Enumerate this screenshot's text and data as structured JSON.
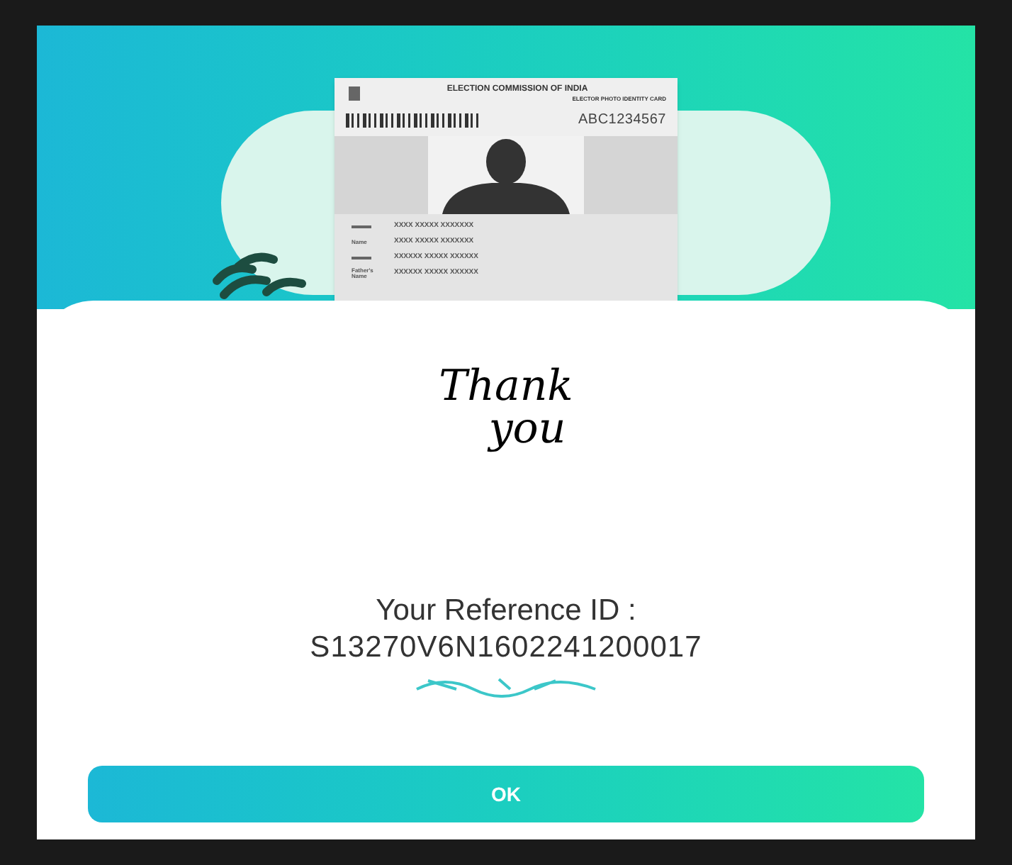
{
  "id_card": {
    "authority": "ELECTION COMMISSION OF INDIA",
    "card_type": "ELECTOR PHOTO IDENTITY CARD",
    "number": "ABC1234567",
    "fields": [
      {
        "value": "XXXX XXXXX XXXXXXX"
      },
      {
        "label": "Name",
        "value": "XXXX XXXXX XXXXXXX"
      },
      {
        "value": "XXXXXX XXXXX XXXXXX"
      },
      {
        "label": "Father's Name",
        "value": "XXXXXX XXXXX XXXXXX"
      }
    ]
  },
  "thank_you": [
    "Thank",
    "you"
  ],
  "reference": {
    "label": "Your Reference ID :",
    "value": "S13270V6N1602241200017"
  },
  "button": "OK"
}
